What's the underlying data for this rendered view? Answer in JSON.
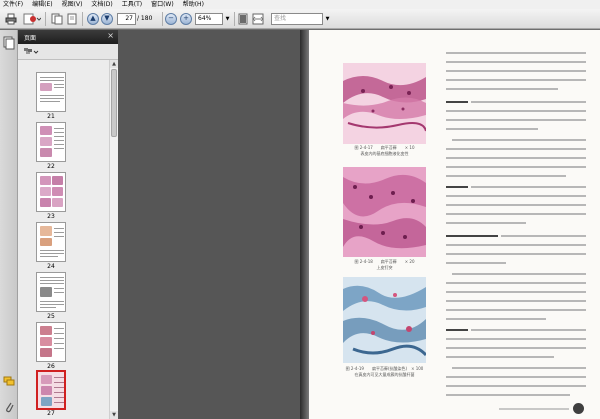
{
  "menu": [
    "文件(F)",
    "编辑(E)",
    "视图(V)",
    "文档(D)",
    "工具(T)",
    "窗口(W)",
    "帮助(H)"
  ],
  "toolbar": {
    "current_page": "27",
    "total_pages": "/ 180",
    "zoom": "64%",
    "search_placeholder": "查找"
  },
  "panel": {
    "title": "页面"
  },
  "thumbnails": [
    {
      "page": "21"
    },
    {
      "page": "22"
    },
    {
      "page": "23"
    },
    {
      "page": "24"
    },
    {
      "page": "25"
    },
    {
      "page": "26"
    },
    {
      "page": "27",
      "selected": true
    }
  ],
  "figures": [
    {
      "caption_line1": "图 2-4-17　　扁平苔藓　　× 10",
      "caption_line2": "表皮内的基底细胞液化变性"
    },
    {
      "caption_line1": "图 2-4-18　　扁平苔藓　　× 20",
      "caption_line2": "上皮钉突"
    },
    {
      "caption_line1": "图 2-4-19　　扁平苔藓(抗酸染色)　× 100",
      "caption_line2": "在真皮内可见大量成簇的抗酸杆菌"
    }
  ],
  "colors": {
    "selection": "#d02020",
    "page_bg": "#fbfaf7",
    "stain_pink": "#d98fb4",
    "stain_blue": "#5f90b8"
  }
}
